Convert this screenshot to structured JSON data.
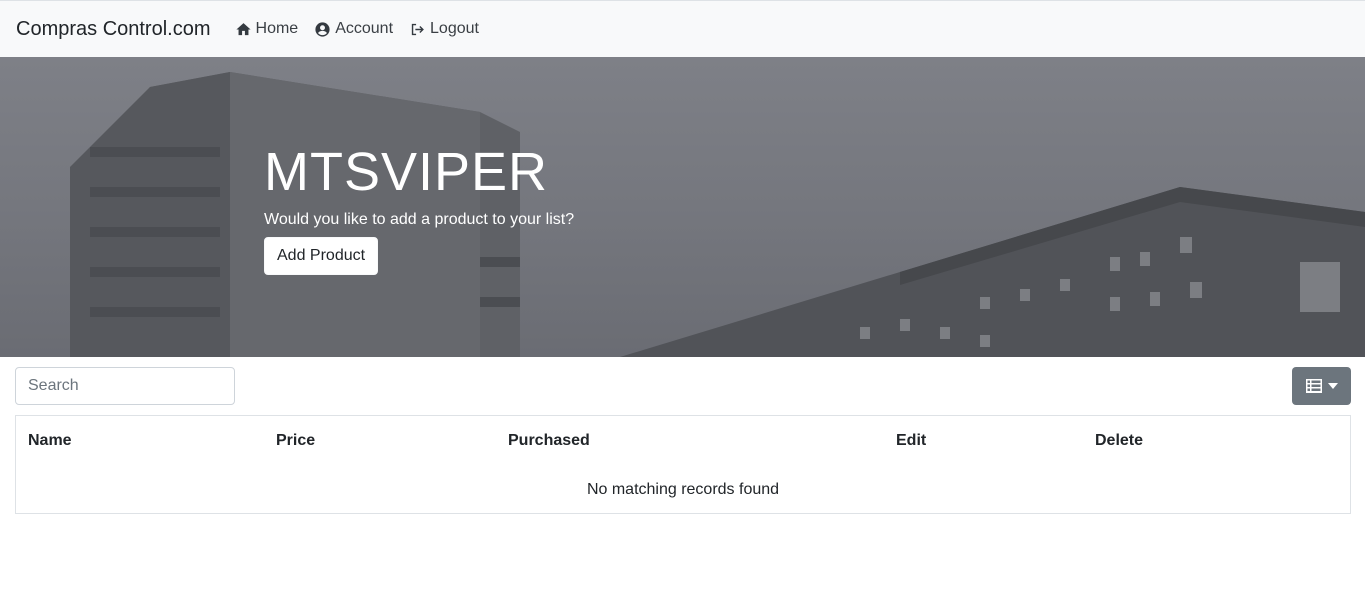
{
  "navbar": {
    "brand": "Compras Control.com",
    "links": [
      {
        "label": "Home",
        "icon": "home-icon"
      },
      {
        "label": "Account",
        "icon": "user-circle-icon"
      },
      {
        "label": "Logout",
        "icon": "logout-icon"
      }
    ]
  },
  "hero": {
    "title": "MTSVIPER",
    "subtitle": "Would you like to add a product to your list?",
    "button_label": "Add Product"
  },
  "search": {
    "placeholder": "Search",
    "value": ""
  },
  "toolbar": {
    "columns_icon": "list-icon"
  },
  "table": {
    "columns": [
      "Name",
      "Price",
      "Purchased",
      "Edit",
      "Delete"
    ],
    "rows": [],
    "empty_message": "No matching records found"
  }
}
